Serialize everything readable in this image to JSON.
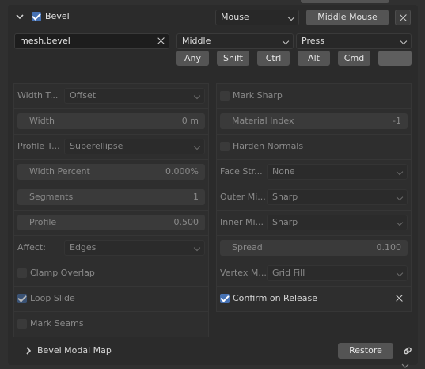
{
  "header": {
    "title": "Bevel",
    "map_type": "Mouse",
    "input_button": "Middle Mouse"
  },
  "row2": {
    "operator_id": "mesh.bevel",
    "event_value": "Middle",
    "event_action": "Press"
  },
  "modifiers": {
    "any": "Any",
    "shift": "Shift",
    "ctrl": "Ctrl",
    "alt": "Alt",
    "cmd": "Cmd"
  },
  "properties": {
    "left": {
      "width_type_label": "Width T...",
      "width_type_value": "Offset",
      "width_label": "Width",
      "width_value": "0 m",
      "profile_type_label": "Profile T...",
      "profile_type_value": "Superellipse",
      "width_percent_label": "Width Percent",
      "width_percent_value": "0.000%",
      "segments_label": "Segments",
      "segments_value": "1",
      "profile_label": "Profile",
      "profile_value": "0.500",
      "affect_label": "Affect:",
      "affect_value": "Edges",
      "clamp_overlap": "Clamp Overlap",
      "loop_slide": "Loop Slide",
      "mark_seams": "Mark Seams"
    },
    "right": {
      "mark_sharp": "Mark Sharp",
      "material_index_label": "Material Index",
      "material_index_value": "-1",
      "harden_normals": "Harden Normals",
      "face_strength_label": "Face Str...",
      "face_strength_value": "None",
      "outer_miter_label": "Outer Mi...",
      "outer_miter_value": "Sharp",
      "inner_miter_label": "Inner Mi...",
      "inner_miter_value": "Sharp",
      "spread_label": "Spread",
      "spread_value": "0.100",
      "vertex_mesh_label": "Vertex M...",
      "vertex_mesh_value": "Grid Fill",
      "confirm_on_release": "Confirm on Release"
    }
  },
  "footer": {
    "modal_map_label": "Bevel Modal Map",
    "restore_label": "Restore"
  },
  "icons": {
    "expand": "chevron-down-icon",
    "collapse": "chevron-right-icon",
    "remove": "close-icon",
    "link": "link-icon"
  },
  "colors": {
    "accent": "#4772b3",
    "background": "#303030",
    "button": "#545454"
  }
}
